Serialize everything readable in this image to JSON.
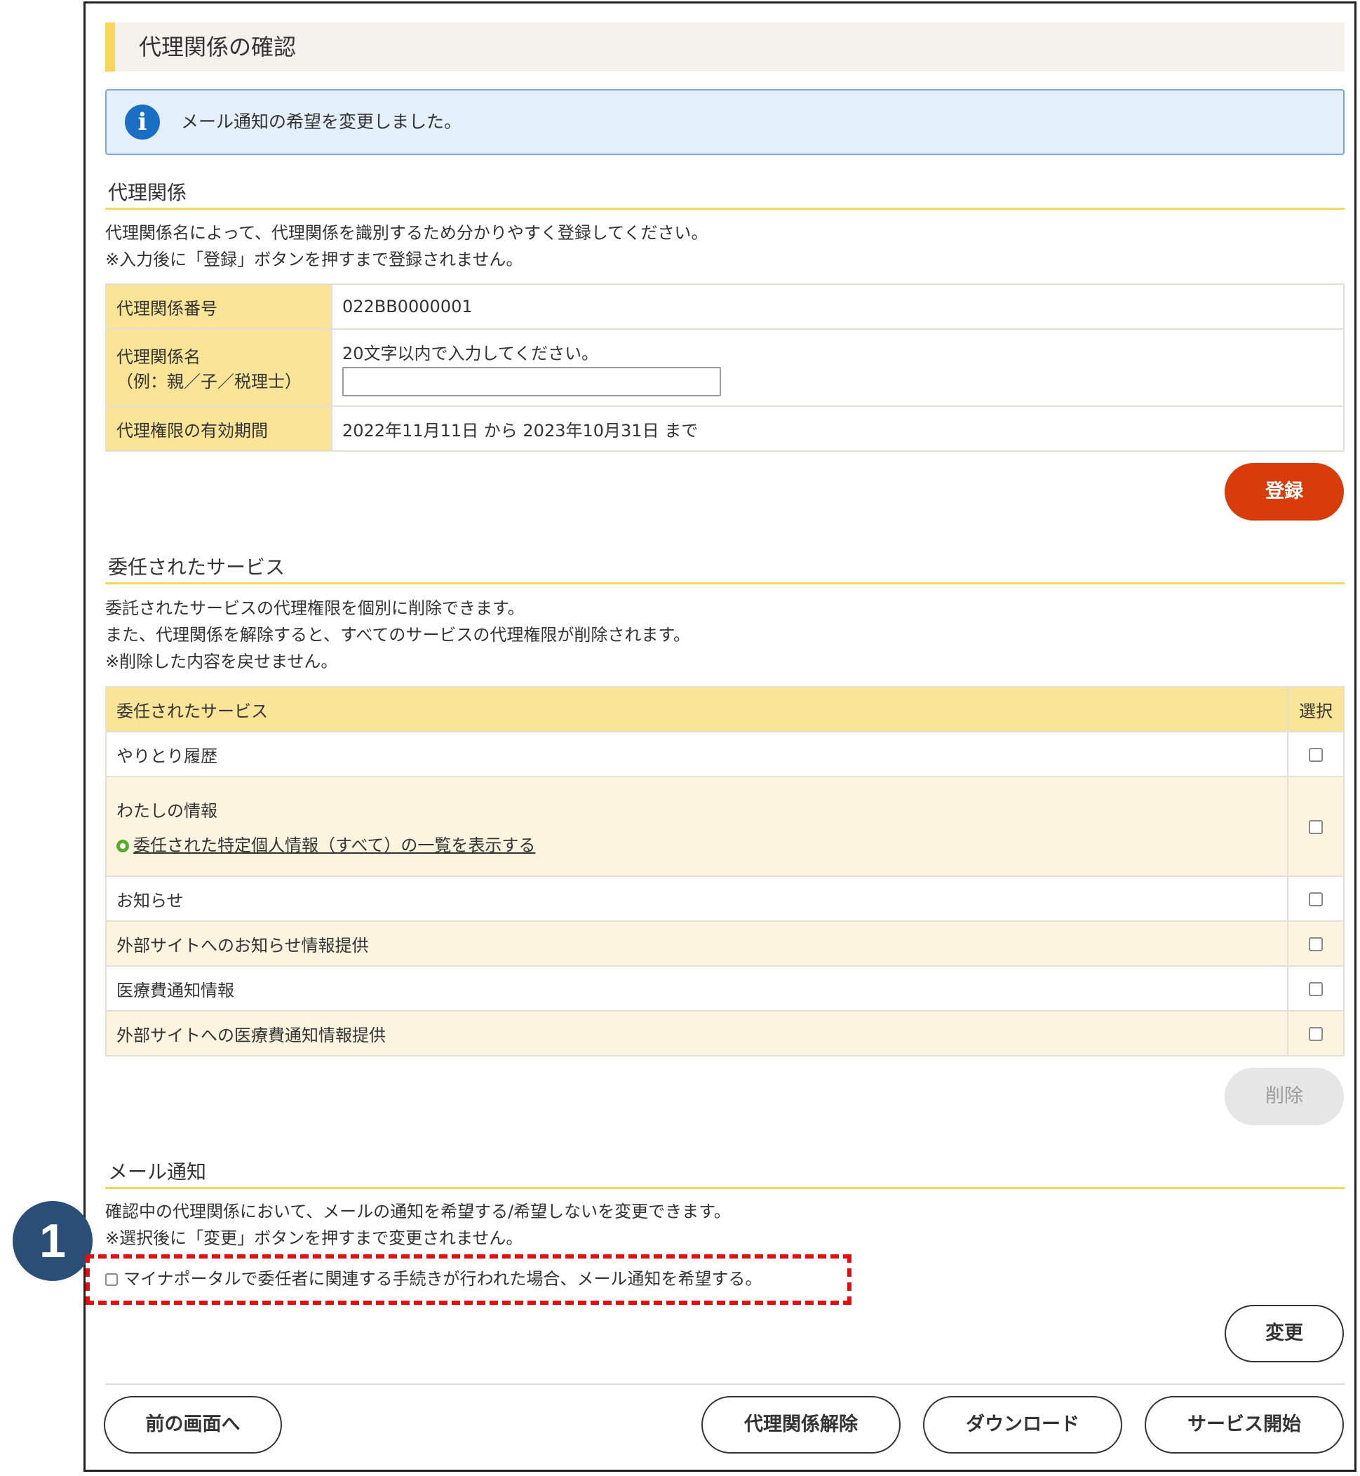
{
  "page": {
    "title": "代理関係の確認",
    "info_message": "メール通知の希望を変更しました。",
    "info_icon": "info-icon"
  },
  "relation": {
    "heading": "代理関係",
    "desc_line1": "代理関係名によって、代理関係を識別するため分かりやすく登録してください。",
    "desc_line2": "※入力後に「登録」ボタンを押すまで登録されません。",
    "rows": {
      "number_label": "代理関係番号",
      "number_value": "022BB0000001",
      "name_label_line1": "代理関係名",
      "name_label_line2": "（例：親／子／税理士）",
      "name_hint": "20文字以内で入力してください。",
      "name_value": "",
      "period_label": "代理権限の有効期間",
      "period_value": "2022年11月11日 から 2023年10月31日 まで"
    },
    "register_button": "登録"
  },
  "services": {
    "heading": "委任されたサービス",
    "desc_line1": "委託されたサービスの代理権限を個別に削除できます。",
    "desc_line2": "また、代理関係を解除すると、すべてのサービスの代理権限が削除されます。",
    "desc_line3": "※削除した内容を戻せません。",
    "col_service": "委任されたサービス",
    "col_select": "選択",
    "items": [
      {
        "label": "やりとり履歴",
        "checked": false
      },
      {
        "label": "わたしの情報",
        "link": "委任された特定個人情報（すべて）の一覧を表示する",
        "checked": false
      },
      {
        "label": "お知らせ",
        "checked": false
      },
      {
        "label": "外部サイトへのお知らせ情報提供",
        "checked": false
      },
      {
        "label": "医療費通知情報",
        "checked": false
      },
      {
        "label": "外部サイトへの医療費通知情報提供",
        "checked": false
      }
    ],
    "delete_button": "削除"
  },
  "mail": {
    "heading": "メール通知",
    "desc_line1": "確認中の代理関係において、メールの通知を希望する/希望しないを変更できます。",
    "desc_line2": "※選択後に「変更」ボタンを押すまで変更されません。",
    "checkbox_label": "マイナポータルで委任者に関連する手続きが行われた場合、メール通知を希望する。",
    "checked": false,
    "change_button": "変更"
  },
  "annotation": {
    "badge": "1",
    "highlight_color": "#e01010"
  },
  "footer": {
    "back_button": "前の画面へ",
    "release_button": "代理関係解除",
    "download_button": "ダウンロード",
    "start_button": "サービス開始"
  },
  "colors": {
    "accent_yellow": "#f7d65a",
    "primary_button": "#d83c0a",
    "info_bg": "#e3f0fb",
    "badge": "#2b4e77"
  }
}
